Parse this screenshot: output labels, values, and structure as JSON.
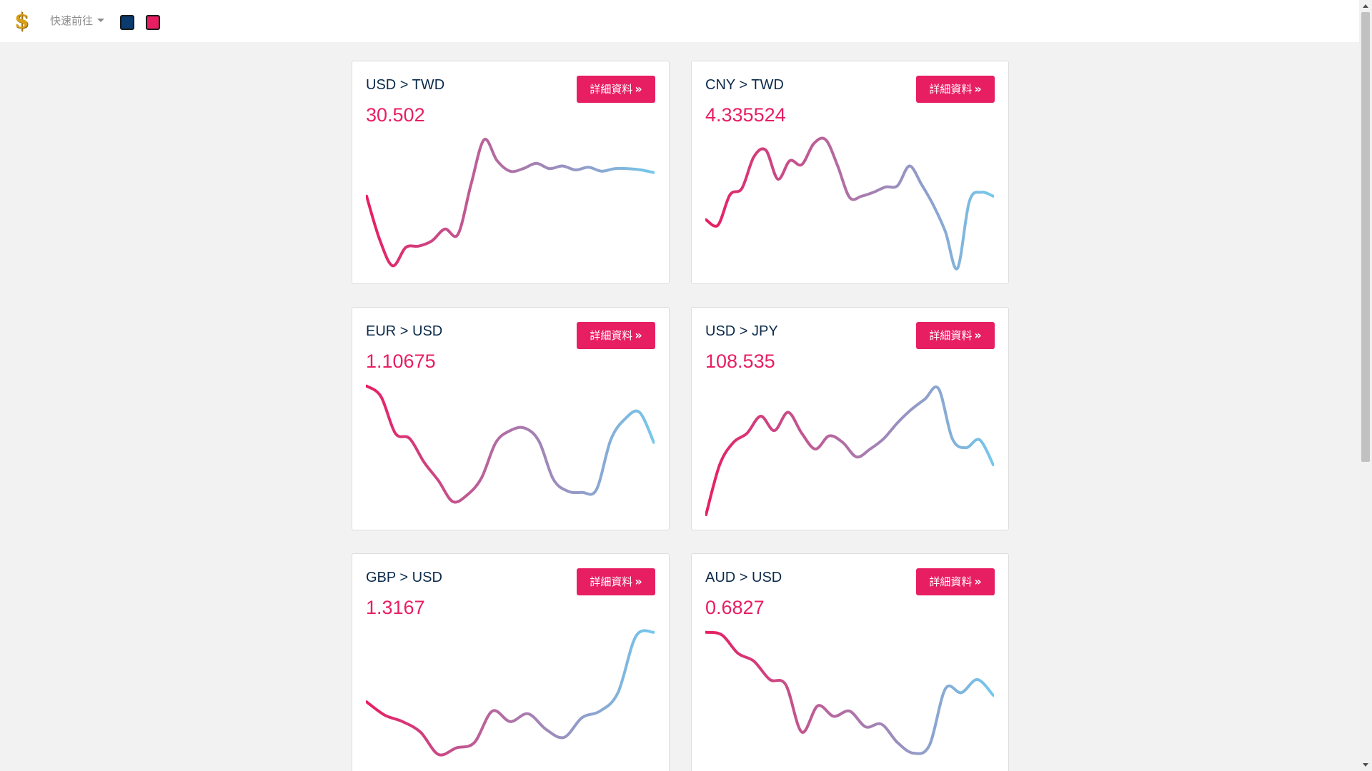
{
  "nav": {
    "logo_symbol": "$",
    "quick_label": "快速前往",
    "theme_swatches": [
      {
        "name": "navy-theme",
        "color": "#0b3a6e"
      },
      {
        "name": "pink-theme",
        "color": "#e81e63"
      }
    ]
  },
  "colors": {
    "accent": "#e81e63",
    "pair_text": "#0b2a4a",
    "line_start": "#e81e63",
    "line_end": "#74c8ec"
  },
  "cards": [
    {
      "pair": "USD > TWD",
      "rate": "30.502",
      "button_label": "詳細資料",
      "trend": [
        0.55,
        0.22,
        0.02,
        0.16,
        0.17,
        0.21,
        0.3,
        0.26,
        0.64,
        0.98,
        0.82,
        0.74,
        0.76,
        0.8,
        0.76,
        0.78,
        0.75,
        0.77,
        0.74,
        0.76,
        0.76,
        0.75,
        0.73
      ]
    },
    {
      "pair": "CNY > TWD",
      "rate": "4.335524",
      "button_label": "詳細資料",
      "trend": [
        0.37,
        0.33,
        0.56,
        0.61,
        0.85,
        0.9,
        0.68,
        0.82,
        0.79,
        0.95,
        0.98,
        0.78,
        0.54,
        0.55,
        0.58,
        0.62,
        0.63,
        0.78,
        0.64,
        0.48,
        0.28,
        0.0,
        0.51,
        0.58,
        0.55
      ]
    },
    {
      "pair": "EUR > USD",
      "rate": "1.10675",
      "button_label": "詳細資料",
      "trend": [
        0.98,
        0.9,
        0.62,
        0.58,
        0.4,
        0.26,
        0.1,
        0.15,
        0.28,
        0.55,
        0.64,
        0.66,
        0.56,
        0.27,
        0.18,
        0.17,
        0.19,
        0.57,
        0.73,
        0.78,
        0.55
      ]
    },
    {
      "pair": "USD > JPY",
      "rate": "108.535",
      "button_label": "詳細資料",
      "trend": [
        0.0,
        0.38,
        0.55,
        0.62,
        0.75,
        0.64,
        0.78,
        0.62,
        0.5,
        0.6,
        0.55,
        0.44,
        0.5,
        0.58,
        0.7,
        0.8,
        0.88,
        0.96,
        0.58,
        0.51,
        0.57,
        0.38
      ]
    },
    {
      "pair": "GBP > USD",
      "rate": "1.3167",
      "button_label": "詳細資料",
      "trend": [
        0.45,
        0.35,
        0.3,
        0.22,
        0.05,
        0.1,
        0.14,
        0.38,
        0.3,
        0.36,
        0.24,
        0.18,
        0.33,
        0.38,
        0.52,
        0.95,
        0.98
      ]
    },
    {
      "pair": "AUD > USD",
      "rate": "0.6827",
      "button_label": "詳細資料",
      "trend": [
        0.98,
        0.96,
        0.82,
        0.76,
        0.62,
        0.58,
        0.22,
        0.42,
        0.34,
        0.38,
        0.26,
        0.28,
        0.14,
        0.06,
        0.12,
        0.55,
        0.52,
        0.62,
        0.5
      ]
    }
  ]
}
